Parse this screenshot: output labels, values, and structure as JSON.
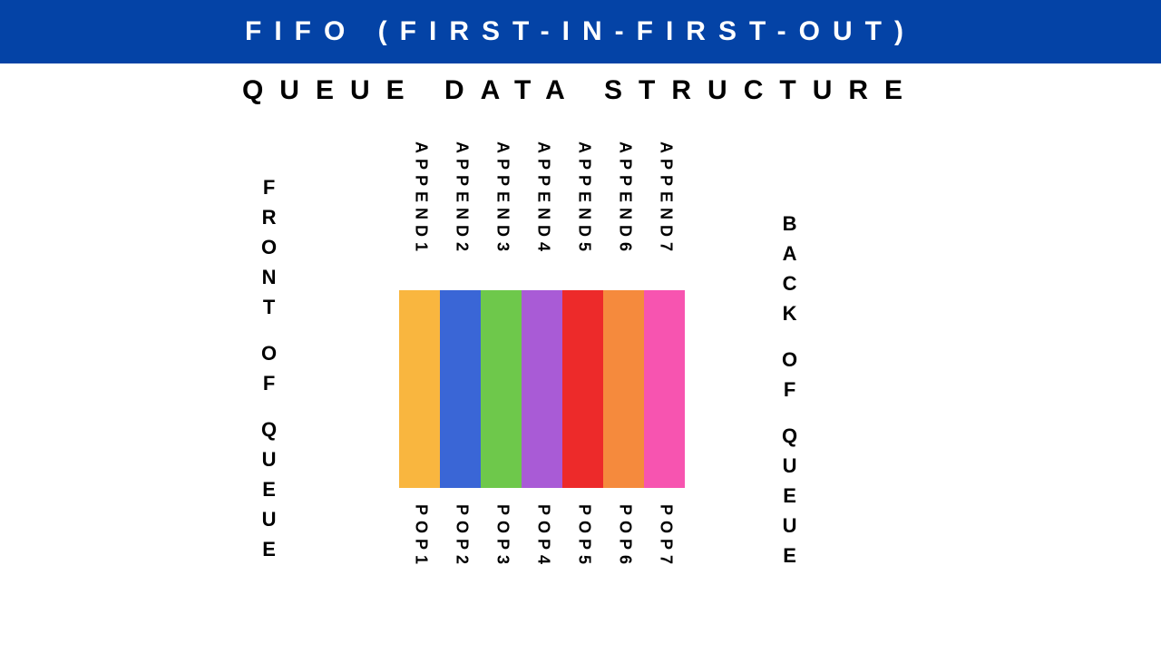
{
  "banner": "FIFO (FIRST-IN-FIRST-OUT)",
  "subtitle": "QUEUE DATA STRUCTURE",
  "front_label_lines": [
    "F",
    "R",
    "O",
    "N",
    "T",
    "",
    "O",
    "F",
    "",
    "Q",
    "U",
    "E",
    "U",
    "E"
  ],
  "back_label_lines": [
    "B",
    "A",
    "C",
    "K",
    "",
    "O",
    "F",
    "",
    "Q",
    "U",
    "E",
    "U",
    "E"
  ],
  "columns": [
    {
      "top": "APPEND1",
      "bottom": "POP1",
      "color": "#f9b63f"
    },
    {
      "top": "APPEND2",
      "bottom": "POP2",
      "color": "#3a66d6"
    },
    {
      "top": "APPEND3",
      "bottom": "POP3",
      "color": "#6ec84b"
    },
    {
      "top": "APPEND4",
      "bottom": "POP4",
      "color": "#a95bd6"
    },
    {
      "top": "APPEND5",
      "bottom": "POP5",
      "color": "#ed2a2a"
    },
    {
      "top": "APPEND6",
      "bottom": "POP6",
      "color": "#f58a3d"
    },
    {
      "top": "APPEND7",
      "bottom": "POP7",
      "color": "#f754b0"
    }
  ]
}
